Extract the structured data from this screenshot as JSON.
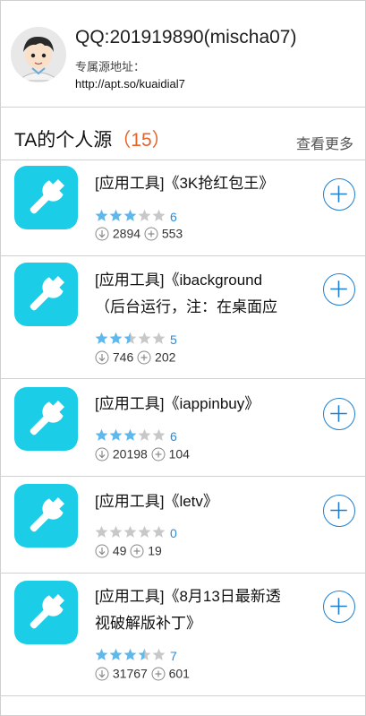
{
  "profile": {
    "qq": "QQ:201919890(mischa07)",
    "source_label": "专属源地址：",
    "source_url": "http://apt.so/kuaidial7"
  },
  "section": {
    "title": "TA的个人源",
    "count": "（15）",
    "more": "查看更多"
  },
  "apps": [
    {
      "name_line1": "[应用工具]《3K抢红包王》",
      "name_line2": "",
      "rating": 3,
      "rating_count": "6",
      "downloads": "2894",
      "adds": "553"
    },
    {
      "name_line1": "[应用工具]《ibackground",
      "name_line2": "（后台运行，注：在桌面应",
      "rating": 2.5,
      "rating_count": "5",
      "downloads": "746",
      "adds": "202"
    },
    {
      "name_line1": "[应用工具]《iappinbuy》",
      "name_line2": "",
      "rating": 3,
      "rating_count": "6",
      "downloads": "20198",
      "adds": "104"
    },
    {
      "name_line1": "[应用工具]《letv》",
      "name_line2": "",
      "rating": 0,
      "rating_count": "0",
      "downloads": "49",
      "adds": "19"
    },
    {
      "name_line1": "[应用工具]《8月13日最新透",
      "name_line2": "视破解版补丁》",
      "rating": 3.5,
      "rating_count": "7",
      "downloads": "31767",
      "adds": "601"
    }
  ],
  "colors": {
    "accent": "#1f7fd0",
    "icon_bg": "#1ccde8",
    "count": "#e5622b",
    "star_on": "#5fb7ea",
    "star_off": "#c8c8c8"
  },
  "icons": {
    "app": "wrench-icon",
    "add": "plus-circle-icon",
    "download": "download-icon",
    "add_small": "plus-small-icon"
  }
}
